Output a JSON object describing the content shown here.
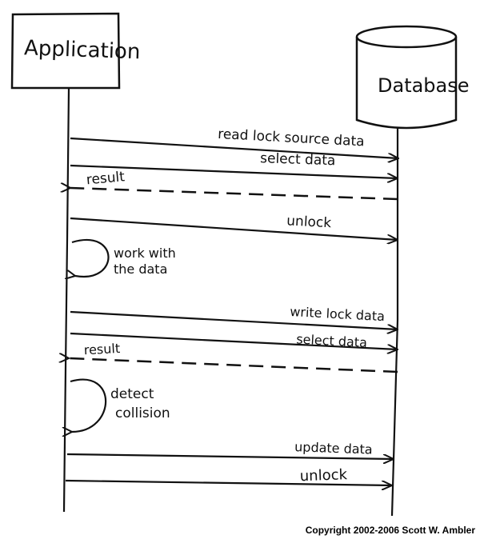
{
  "participants": {
    "application": {
      "label": "Application"
    },
    "database": {
      "label": "Database"
    }
  },
  "messages": [
    {
      "label": "read lock source data",
      "style": "solid"
    },
    {
      "label": "select data",
      "style": "solid"
    },
    {
      "label": "result",
      "style": "dashed"
    },
    {
      "label": "unlock",
      "style": "solid"
    },
    {
      "label": "work with the data",
      "style": "self"
    },
    {
      "label": "write lock data",
      "style": "solid"
    },
    {
      "label": "select data",
      "style": "solid"
    },
    {
      "label": "result",
      "style": "dashed"
    },
    {
      "label": "detect collision",
      "style": "self"
    },
    {
      "label": "update data",
      "style": "solid"
    },
    {
      "label": "unlock",
      "style": "solid"
    }
  ],
  "self_labels": {
    "work_line1": "work with",
    "work_line2": "the data",
    "detect_line1": "detect",
    "detect_line2": "collision"
  },
  "footer": {
    "copyright": "Copyright 2002-2006 Scott W. Ambler"
  },
  "colors": {
    "ink": "#111111",
    "background": "#ffffff"
  }
}
